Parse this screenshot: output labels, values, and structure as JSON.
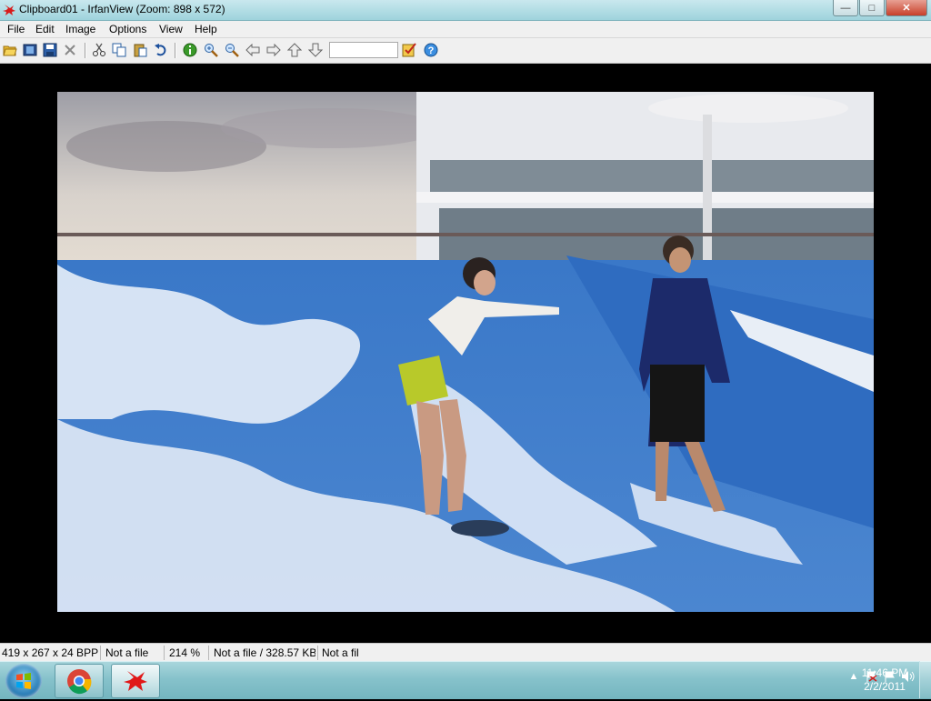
{
  "window": {
    "title": "Clipboard01 - IrfanView (Zoom: 898 x 572)",
    "controls": {
      "minimize": "—",
      "maximize": "□",
      "close": "✕"
    }
  },
  "menu": [
    "File",
    "Edit",
    "Image",
    "Options",
    "View",
    "Help"
  ],
  "toolbar": {
    "icons": [
      "open-folder-icon",
      "slideshow-icon",
      "save-icon",
      "delete-icon",
      "cut-icon",
      "copy-icon",
      "paste-icon",
      "undo-icon",
      "info-icon",
      "zoom-in-icon",
      "zoom-out-icon",
      "previous-icon",
      "next-icon",
      "first-file-icon",
      "last-file-icon",
      "settings-icon",
      "help-icon"
    ],
    "page_field_value": ""
  },
  "status_bar": {
    "dimensions": "419 x 267 x 24 BPP",
    "file": "Not a file",
    "zoom": "214 %",
    "file_size": "Not a file / 328.57 KB",
    "extra": "Not a fil"
  },
  "taskbar": {
    "pinned": [
      "windows-start",
      "chrome",
      "irfanview"
    ],
    "clock_time": "11:46 PM",
    "clock_date": "2/2/2011"
  },
  "colors": {
    "titlebar": "#9ed3dc",
    "taskbar": "#86c2cb",
    "viewer_bg": "#000000",
    "wave_blue": "#3a78c8"
  }
}
